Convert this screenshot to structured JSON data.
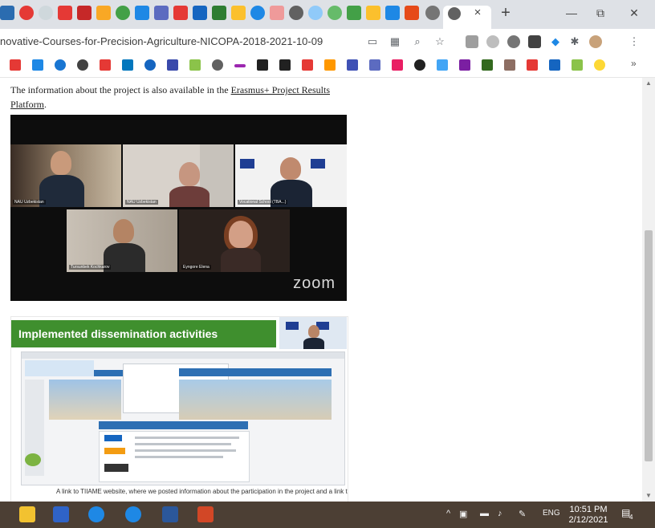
{
  "browser": {
    "tab_close": "×",
    "new_tab": "+",
    "window_minimize": "—",
    "window_restore": "⧉",
    "window_close": "✕",
    "url": "novative-Courses-for-Precision-Agriculture-NICOPA-2018-2021-10-09",
    "bookmarks_more": "»"
  },
  "article": {
    "text_before": "The information about the project is also available in the ",
    "link_text": "Erasmus+ Project Results Platform",
    "text_after": "."
  },
  "zoom_meeting": {
    "logo": "zoom",
    "participants": [
      "NAU Uzbekistan",
      "NAU Uzbekistan",
      "Vocational School (TBA...)",
      "Tursunbek Kochkarov",
      "Eyngore Elena"
    ]
  },
  "slide": {
    "title": "Implemented dissemination activities",
    "caption": "A link to TIIAME website, where we posted information about the participation in the project and a link to"
  },
  "taskbar": {
    "time": "10:51 PM",
    "date": "2/12/2021",
    "language": "ENG",
    "notifications": "4"
  },
  "colors": {
    "slide_green": "#3f8f2e",
    "taskbar": "#4c3f34",
    "tab_strip": "#dee1e6"
  }
}
